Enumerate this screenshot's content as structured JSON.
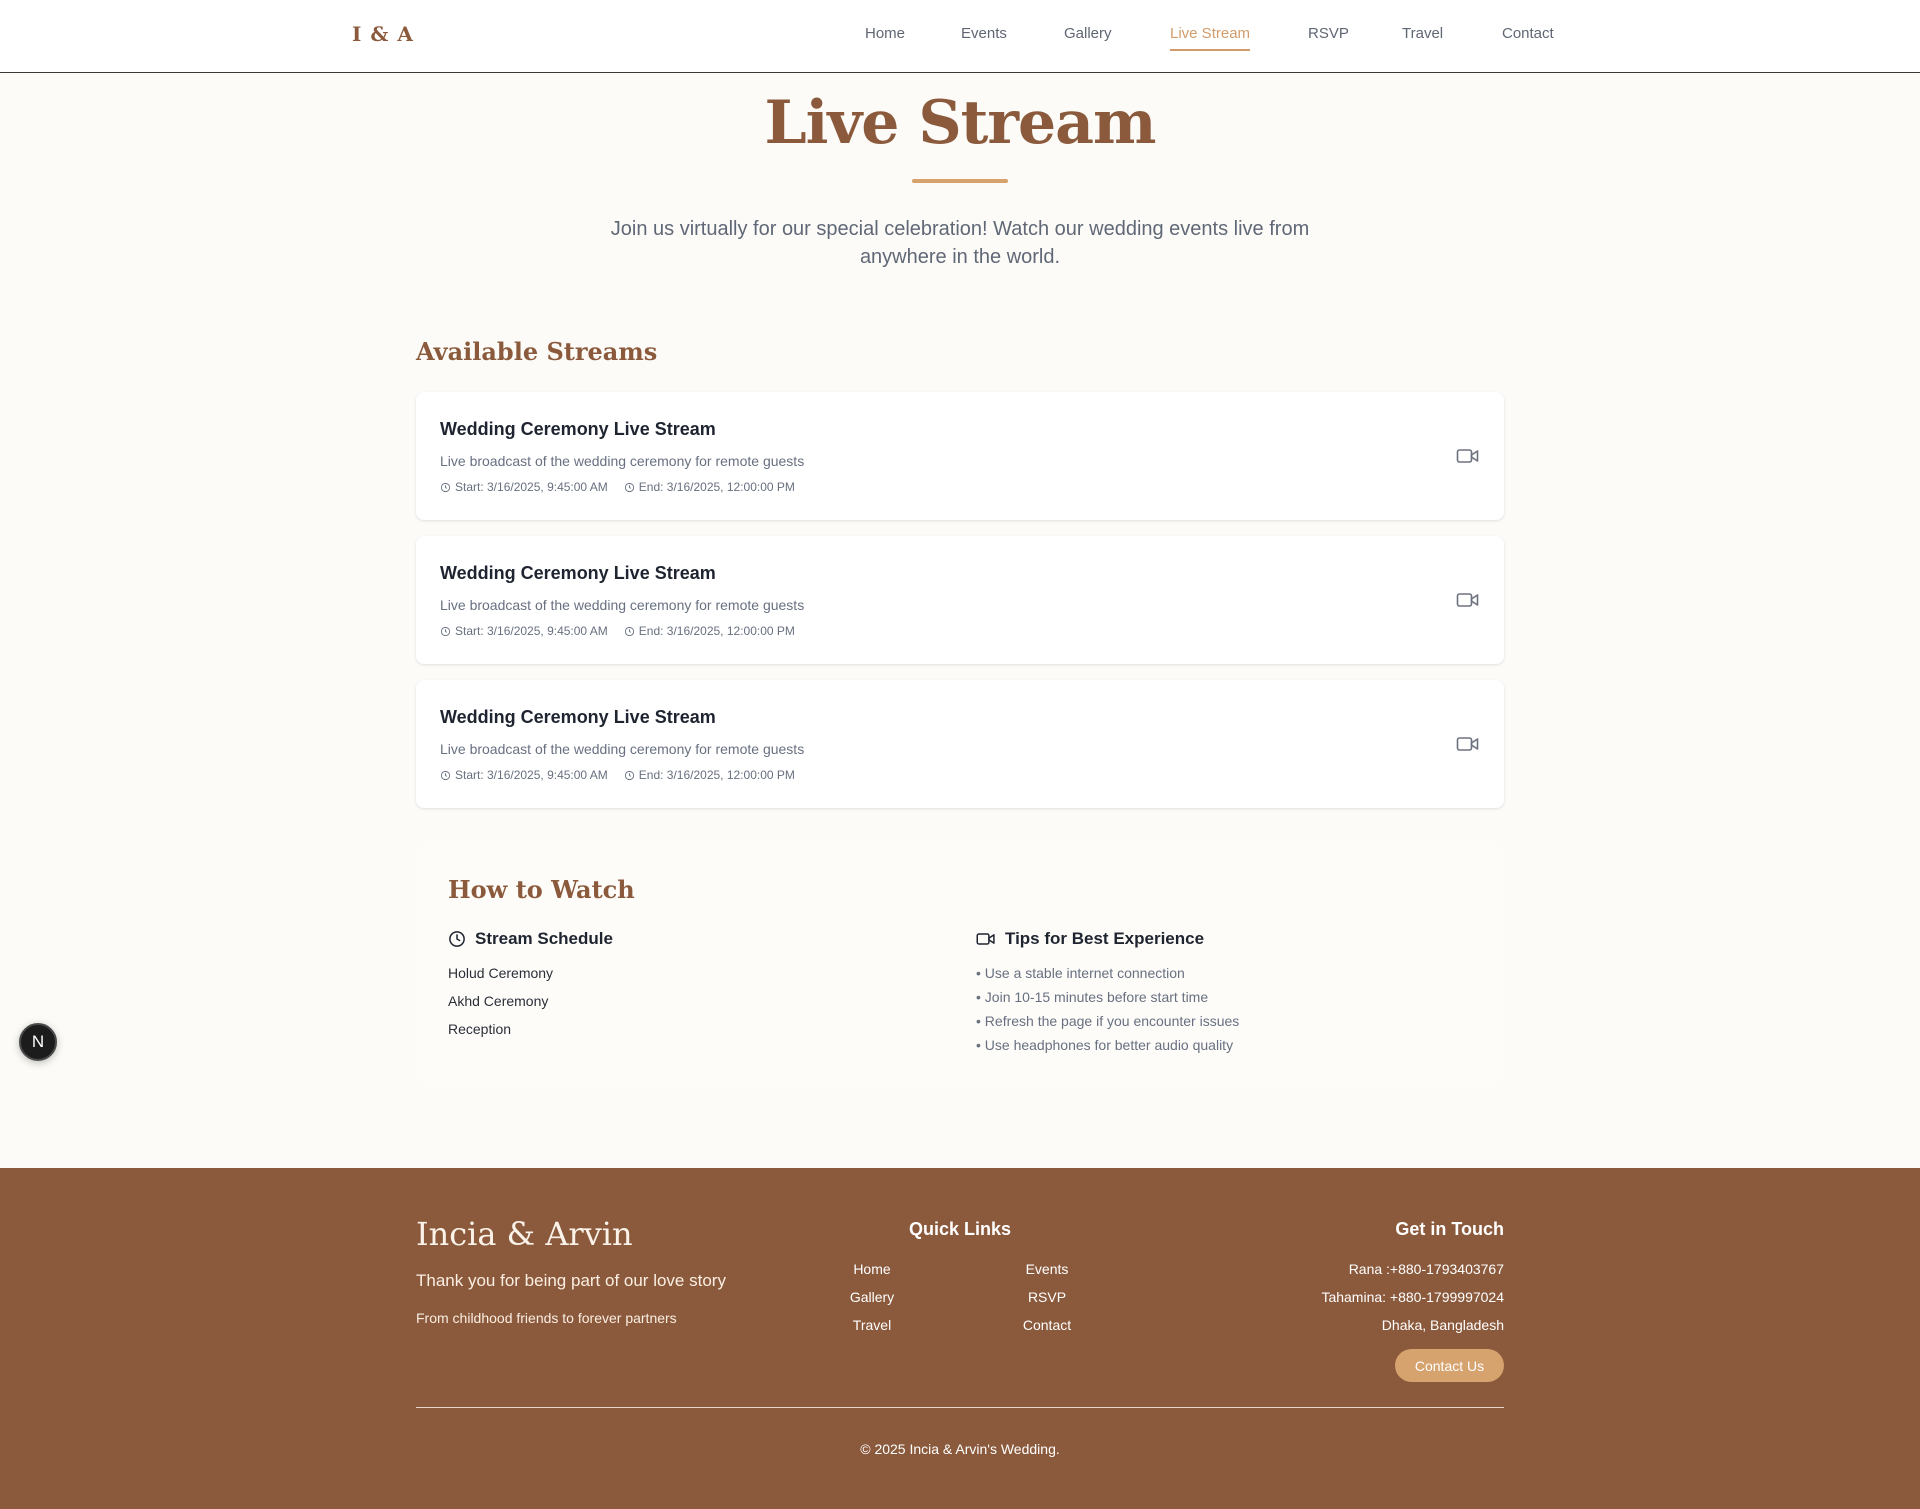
{
  "nav": {
    "logo": "I & A",
    "links": [
      {
        "label": "Home",
        "active": false
      },
      {
        "label": "Events",
        "active": false
      },
      {
        "label": "Gallery",
        "active": false
      },
      {
        "label": "Live Stream",
        "active": true
      },
      {
        "label": "RSVP",
        "active": false
      },
      {
        "label": "Travel",
        "active": false
      },
      {
        "label": "Contact",
        "active": false
      }
    ]
  },
  "hero": {
    "title": "Live Stream",
    "subtitle": "Join us virtually for our special celebration! Watch our wedding events live from anywhere in the world."
  },
  "streams": {
    "heading": "Available Streams",
    "items": [
      {
        "title": "Wedding Ceremony Live Stream",
        "description": "Live broadcast of the wedding ceremony for remote guests",
        "start": "Start: 3/16/2025, 9:45:00 AM",
        "end": "End: 3/16/2025, 12:00:00 PM",
        "icon": "video-camera-icon"
      },
      {
        "title": "Wedding Ceremony Live Stream",
        "description": "Live broadcast of the wedding ceremony for remote guests",
        "start": "Start: 3/16/2025, 9:45:00 AM",
        "end": "End: 3/16/2025, 12:00:00 PM",
        "icon": "video-camera-icon"
      },
      {
        "title": "Wedding Ceremony Live Stream",
        "description": "Live broadcast of the wedding ceremony for remote guests",
        "start": "Start: 3/16/2025, 9:45:00 AM",
        "end": "End: 3/16/2025, 12:00:00 PM",
        "icon": "video-camera-icon"
      }
    ]
  },
  "how_to_watch": {
    "heading": "How to Watch",
    "schedule": {
      "title": "Stream Schedule",
      "icon": "clock-icon",
      "items": [
        "Holud Ceremony",
        "Akhd Ceremony",
        "Reception"
      ]
    },
    "tips": {
      "title": "Tips for Best Experience",
      "icon": "video-camera-icon",
      "items": [
        "• Use a stable internet connection",
        "• Join 10-15 minutes before start time",
        "• Refresh the page if you encounter issues",
        "• Use headphones for better audio quality"
      ]
    }
  },
  "badge": {
    "label": "N"
  },
  "footer": {
    "names": "Incia & Arvin",
    "thanks": "Thank you for being part of our love story",
    "tagline": "From childhood friends to forever partners",
    "quick_links": {
      "title": "Quick Links",
      "links": [
        "Home",
        "Events",
        "Gallery",
        "RSVP",
        "Travel",
        "Contact"
      ]
    },
    "contact": {
      "title": "Get in Touch",
      "lines": [
        "Rana :+880-1793403767",
        "Tahamina: +880-1799997024",
        "Dhaka, Bangladesh"
      ],
      "button": "Contact Us"
    },
    "copyright": "© 2025 Incia & Arvin's Wedding."
  },
  "colors": {
    "brand_brown": "#8b5a3c",
    "accent_tan": "#d6a26e",
    "page_bg": "#fcfbf7"
  }
}
